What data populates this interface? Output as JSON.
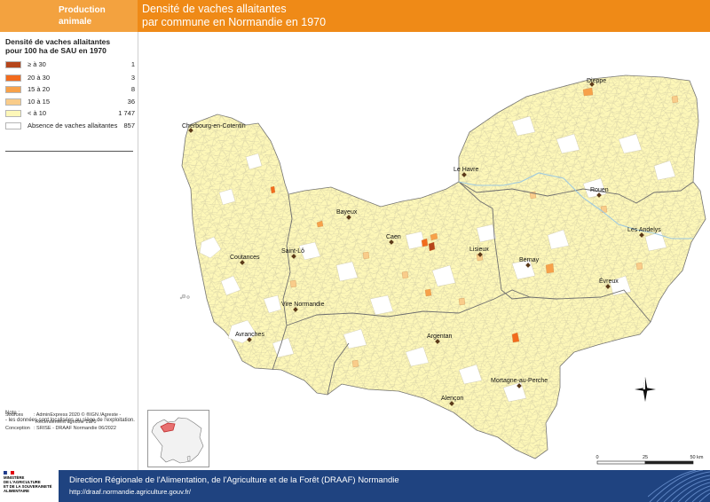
{
  "header": {
    "category_line1": "Production",
    "category_line2": "animale",
    "title_line1": "Densité de vaches allaitantes",
    "title_line2": "par commune en Normandie en 1970"
  },
  "legend": {
    "title_line1": "Densité de vaches allaitantes",
    "title_line2": "pour 100 ha de SAU en 1970",
    "classes": [
      {
        "label": "≥ à 30",
        "count": "1",
        "color": "#b5451b"
      },
      {
        "label": "20 à 30",
        "count": "3",
        "color": "#f26b1d"
      },
      {
        "label": "15 à 20",
        "count": "8",
        "color": "#f7a14a"
      },
      {
        "label": "10 à 15",
        "count": "36",
        "color": "#f9cc8a"
      },
      {
        "label": "< à 10",
        "count": "1 747",
        "color": "#fdf7b8"
      },
      {
        "label": "Absence de vaches allaitantes",
        "count": "857",
        "color": "#ffffff"
      }
    ]
  },
  "note": {
    "line1": "Note :",
    "line2": "- les données sont localisées au siège de l'exploitation."
  },
  "sources": {
    "label": "Sources",
    "line1": ": AdminExpress 2020 © ®IGN /Agreste -",
    "line2": "Recensement agricole 1970",
    "conception_label": "Conception",
    "conception": ": SRISE - DRAAF Normandie 06/2022"
  },
  "map": {
    "cities": [
      {
        "name": "Dieppe"
      },
      {
        "name": "Cherbourg-en-Cotentin"
      },
      {
        "name": "Le Havre"
      },
      {
        "name": "Rouen"
      },
      {
        "name": "Bayeux"
      },
      {
        "name": "Caen"
      },
      {
        "name": "Lisieux"
      },
      {
        "name": "Les Andelys"
      },
      {
        "name": "Saint-Lô"
      },
      {
        "name": "Coutances"
      },
      {
        "name": "Bernay"
      },
      {
        "name": "Évreux"
      },
      {
        "name": "Vire Normandie"
      },
      {
        "name": "Avranches"
      },
      {
        "name": "Argentan"
      },
      {
        "name": "Mortagne-au-Perche"
      },
      {
        "name": "Alençon"
      }
    ],
    "scale": {
      "t0": "0",
      "t1": "25",
      "t2": "50 km"
    },
    "colors": {
      "land": "#fdf7b8",
      "sea": "#ffffff",
      "border": "#6e6e6e",
      "commune": "#c9c4a4",
      "city": "#5b3a1a"
    }
  },
  "footer": {
    "org": "Direction Régionale de l'Alimentation, de l'Agriculture et de la Forêt (DRAAF) Normandie",
    "url": "http://draaf.normandie.agriculture.gouv.fr/",
    "logo_line1": "MINISTÈRE",
    "logo_line2": "DE L'AGRICULTURE",
    "logo_line3": "ET DE LA SOUVERAINETÉ",
    "logo_line4": "ALIMENTAIRE"
  }
}
